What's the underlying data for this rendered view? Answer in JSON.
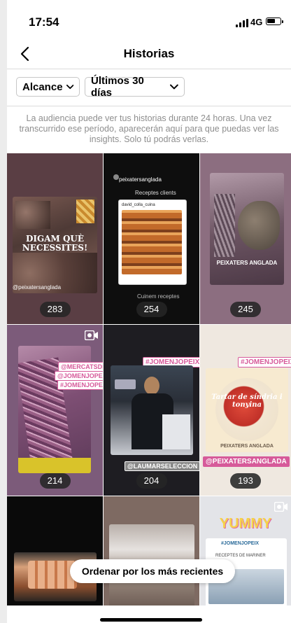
{
  "status_bar": {
    "time": "17:54",
    "network": "4G"
  },
  "header": {
    "title": "Historias"
  },
  "filters": {
    "reach_label": "Alcance",
    "period_label": "Últimos 30 días"
  },
  "info_text": "La audiencia puede ver tus historias durante 24 horas. Una vez transcurrido ese período, aparecerán aquí para que puedas ver las insights. Solo tú podrás verlas.",
  "stories": [
    {
      "count": "283",
      "overlay": "DIGAM QUÈ NECESSITES!",
      "handle": "@peixatersanglada"
    },
    {
      "count": "254",
      "overlay": "Receptes clients",
      "caption": "Cuinem receptes",
      "account": "peixatersanglada",
      "mention": "david_colla_cuina"
    },
    {
      "count": "245",
      "overlay": "PEIXATERS ANGLADA",
      "account": "peixatersanglada"
    },
    {
      "count": "214",
      "tags": [
        "@MERCATSDB",
        "@JOMENJOPEIX",
        "#JOMENJOPEIX"
      ]
    },
    {
      "count": "204",
      "tags": [
        "#JOMENJOPEIX",
        "@LAUMARSELECCION"
      ]
    },
    {
      "count": "193",
      "tags": [
        "#JOMENJOPEIX",
        "@PEIXATERSANGLADA"
      ],
      "overlay": "Tartar de síndria i tonyina",
      "brand": "PEIXATERS ANGLADA"
    },
    {
      "count": ""
    },
    {
      "count": ""
    },
    {
      "count": "",
      "overlay": "YUMMY",
      "tag": "#JOMENJOPEIX",
      "caption": "RECEPTES DE MARINER"
    }
  ],
  "sort_button": {
    "label": "Ordenar por los más recientes"
  }
}
